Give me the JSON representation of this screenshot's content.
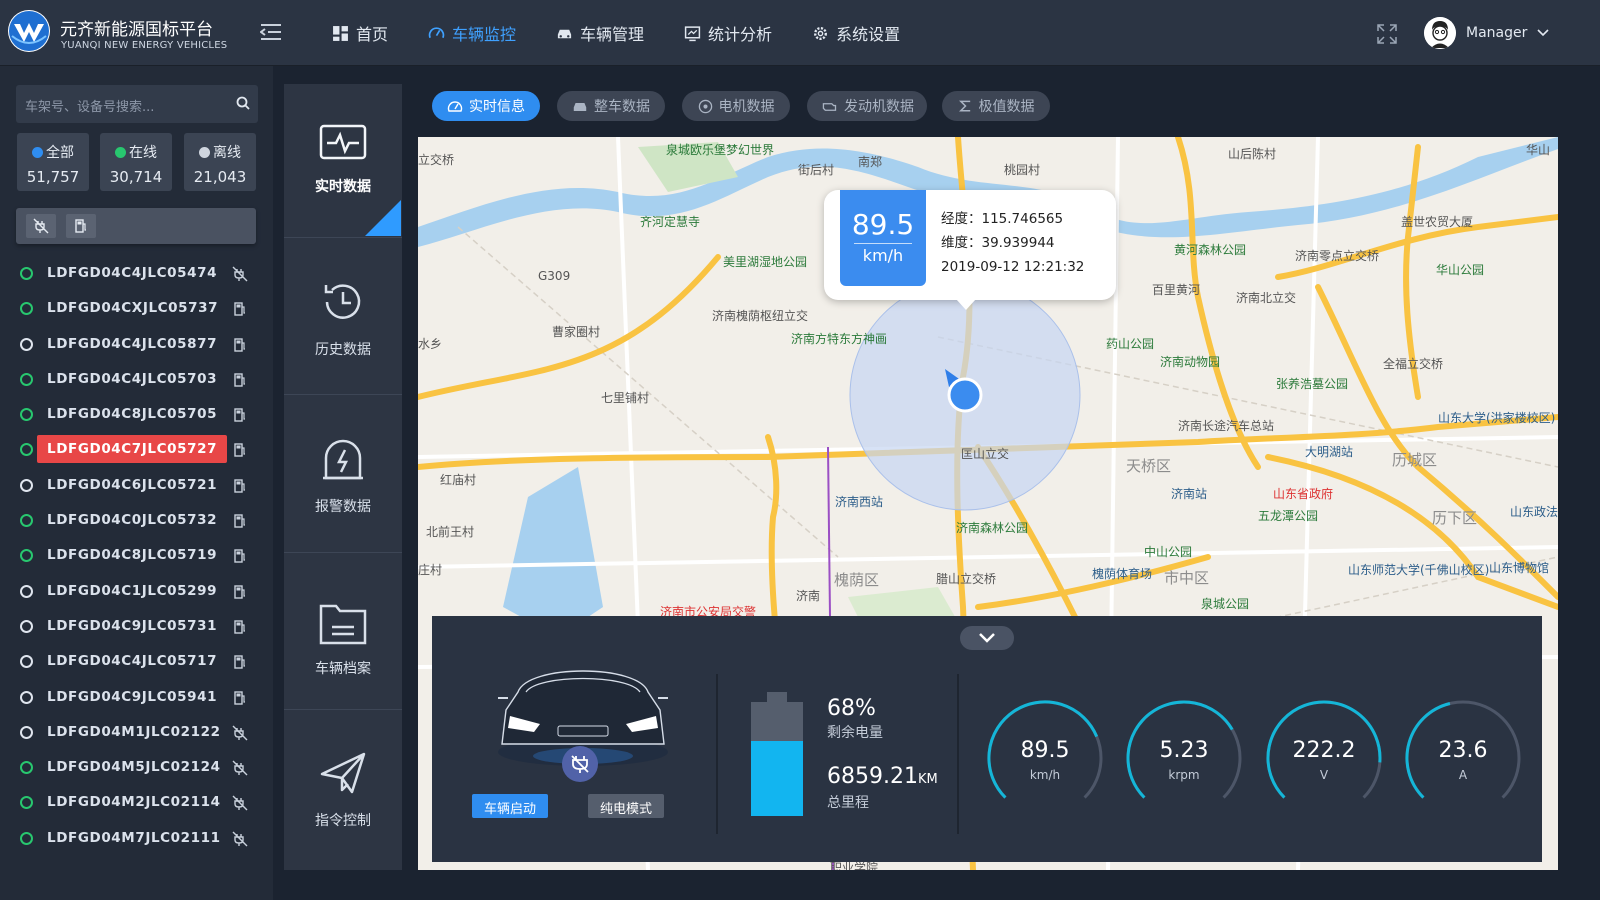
{
  "brand": {
    "title": "元齐新能源国标平台",
    "subtitle": "YUANQI NEW ENERGY VEHICLES"
  },
  "nav": [
    {
      "label": "首页",
      "icon": "dashboard-icon"
    },
    {
      "label": "车辆监控",
      "icon": "speedometer-icon",
      "active": true
    },
    {
      "label": "车辆管理",
      "icon": "car-icon"
    },
    {
      "label": "统计分析",
      "icon": "monitor-chart-icon"
    },
    {
      "label": "系统设置",
      "icon": "gear-icon"
    }
  ],
  "user": {
    "name": "Manager"
  },
  "search": {
    "placeholder": "车架号、设备号搜索..."
  },
  "stats": [
    {
      "label": "全部",
      "value": "51,757",
      "color": "#2f8df0"
    },
    {
      "label": "在线",
      "value": "30,714",
      "color": "#28c76f"
    },
    {
      "label": "离线",
      "value": "21,043",
      "color": "#cfd5de"
    }
  ],
  "vehicles": [
    {
      "id": "LDFGD04C4JLC05474",
      "online": true,
      "icon": "unplugged"
    },
    {
      "id": "LDFGD04CXJLC05737",
      "online": true,
      "icon": "fuel"
    },
    {
      "id": "LDFGD04C4JLC05877",
      "online": false,
      "icon": "fuel"
    },
    {
      "id": "LDFGD04C4JLC05703",
      "online": true,
      "icon": "fuel"
    },
    {
      "id": "LDFGD04C8JLC05705",
      "online": true,
      "icon": "fuel"
    },
    {
      "id": "LDFGD04C7JLC05727",
      "online": true,
      "icon": "fuel",
      "selected": true
    },
    {
      "id": "LDFGD04C6JLC05721",
      "online": false,
      "icon": "fuel"
    },
    {
      "id": "LDFGD04C0JLC05732",
      "online": true,
      "icon": "fuel"
    },
    {
      "id": "LDFGD04C8JLC05719",
      "online": true,
      "icon": "fuel"
    },
    {
      "id": "LDFGD04C1JLC05299",
      "online": false,
      "icon": "fuel"
    },
    {
      "id": "LDFGD04C9JLC05731",
      "online": false,
      "icon": "fuel"
    },
    {
      "id": "LDFGD04C4JLC05717",
      "online": false,
      "icon": "fuel"
    },
    {
      "id": "LDFGD04C9JLC05941",
      "online": false,
      "icon": "fuel"
    },
    {
      "id": "LDFGD04M1JLC02122",
      "online": false,
      "icon": "unplugged"
    },
    {
      "id": "LDFGD04M5JLC02124",
      "online": true,
      "icon": "unplugged"
    },
    {
      "id": "LDFGD04M2JLC02114",
      "online": true,
      "icon": "unplugged"
    },
    {
      "id": "LDFGD04M7JLC02111",
      "online": true,
      "icon": "unplugged"
    }
  ],
  "side_menu": [
    {
      "label": "实时数据",
      "icon": "pulse-monitor-icon",
      "active": true
    },
    {
      "label": "历史数据",
      "icon": "history-icon"
    },
    {
      "label": "报警数据",
      "icon": "alarm-icon"
    },
    {
      "label": "车辆档案",
      "icon": "folder-icon"
    },
    {
      "label": "指令控制",
      "icon": "send-icon"
    }
  ],
  "tabs": [
    {
      "label": "实时信息",
      "icon": "gauge-icon",
      "active": true
    },
    {
      "label": "整车数据",
      "icon": "car-icon"
    },
    {
      "label": "电机数据",
      "icon": "motor-icon"
    },
    {
      "label": "发动机数据",
      "icon": "engine-icon"
    },
    {
      "label": "极值数据",
      "icon": "sigma-icon"
    }
  ],
  "popup": {
    "speed": "89.5",
    "speed_unit": "km/h",
    "longitude_label": "经度：",
    "longitude": "115.746565",
    "latitude_label": "维度：",
    "latitude": "39.939944",
    "time": "2019-09-12 12:21:32"
  },
  "map_labels": [
    "泉城欧乐堡梦幻世界",
    "齐河定慧寺",
    "美里湖湿地公园",
    "济南槐荫枢纽立交",
    "济南方特东方神画",
    "匡山立交",
    "济南西站",
    "济南森林公园",
    "腊山立交桥",
    "槐荫区",
    "济南市公安局交警",
    "黄河森林公园",
    "百里黄河",
    "药山公园",
    "济南动物园",
    "张养浩墓公园",
    "济南长途汽车总站",
    "天桥区",
    "济南站",
    "大明湖站",
    "山东省政府",
    "五龙潭公园",
    "中山公园",
    "槐荫体育场",
    "市中区",
    "泉城公园",
    "济南零点立交桥",
    "济南北立交",
    "全福立交桥",
    "历城区",
    "历下区",
    "盖世农贸大厦",
    "华山公园",
    "山东大学(洪家楼校区)",
    "山东师范大学(千佛山校区)",
    "山东博物馆",
    "山东政法(茂岭校区)",
    "立交桥",
    "水乡",
    "七里铺村",
    "曹家圈村",
    "北前王村",
    "红庙村",
    "庄村",
    "山后陈村",
    "华山",
    "南郑",
    "街后村",
    "桃园村",
    "G309",
    "济南",
    "职业学院"
  ],
  "vehicle_panel": {
    "start_button": "车辆启动",
    "mode_button": "纯电模式",
    "battery_percent": "68%",
    "battery_level": 0.68,
    "battery_label": "剩余电量",
    "mileage": "6859.21",
    "mileage_unit": "KM",
    "mileage_label": "总里程"
  },
  "gauges": [
    {
      "value": "89.5",
      "unit": "km/h",
      "fraction": 0.75
    },
    {
      "value": "5.23",
      "unit": "krpm",
      "fraction": 0.72
    },
    {
      "value": "222.2",
      "unit": "V",
      "fraction": 0.85
    },
    {
      "value": "23.6",
      "unit": "A",
      "fraction": 0.45
    }
  ],
  "colors": {
    "accent": "#2f8df0",
    "online": "#28c76f",
    "selected": "#e84747",
    "gauge": "#14b6d8"
  }
}
